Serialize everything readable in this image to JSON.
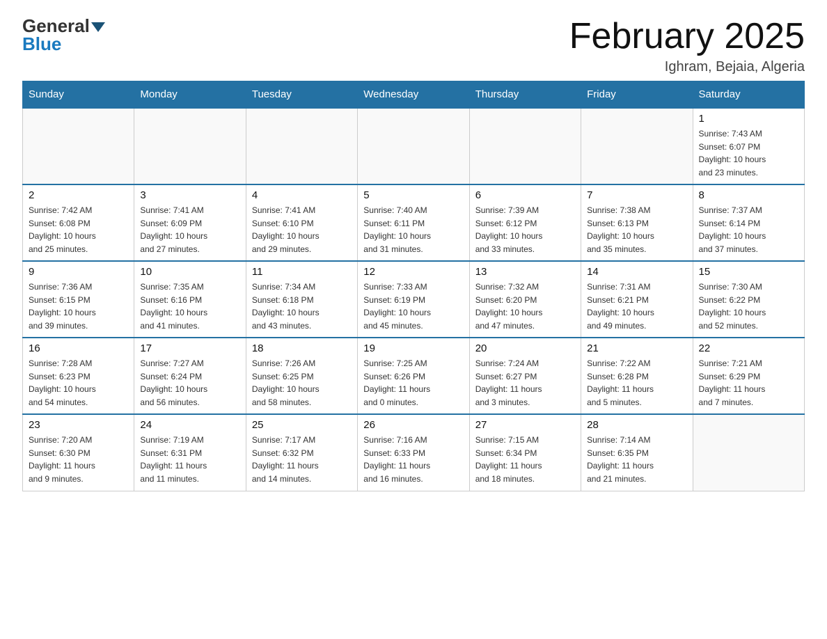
{
  "logo": {
    "general": "General",
    "blue": "Blue"
  },
  "header": {
    "month_year": "February 2025",
    "location": "Ighram, Bejaia, Algeria"
  },
  "weekdays": [
    "Sunday",
    "Monday",
    "Tuesday",
    "Wednesday",
    "Thursday",
    "Friday",
    "Saturday"
  ],
  "weeks": [
    [
      {
        "day": "",
        "info": ""
      },
      {
        "day": "",
        "info": ""
      },
      {
        "day": "",
        "info": ""
      },
      {
        "day": "",
        "info": ""
      },
      {
        "day": "",
        "info": ""
      },
      {
        "day": "",
        "info": ""
      },
      {
        "day": "1",
        "info": "Sunrise: 7:43 AM\nSunset: 6:07 PM\nDaylight: 10 hours\nand 23 minutes."
      }
    ],
    [
      {
        "day": "2",
        "info": "Sunrise: 7:42 AM\nSunset: 6:08 PM\nDaylight: 10 hours\nand 25 minutes."
      },
      {
        "day": "3",
        "info": "Sunrise: 7:41 AM\nSunset: 6:09 PM\nDaylight: 10 hours\nand 27 minutes."
      },
      {
        "day": "4",
        "info": "Sunrise: 7:41 AM\nSunset: 6:10 PM\nDaylight: 10 hours\nand 29 minutes."
      },
      {
        "day": "5",
        "info": "Sunrise: 7:40 AM\nSunset: 6:11 PM\nDaylight: 10 hours\nand 31 minutes."
      },
      {
        "day": "6",
        "info": "Sunrise: 7:39 AM\nSunset: 6:12 PM\nDaylight: 10 hours\nand 33 minutes."
      },
      {
        "day": "7",
        "info": "Sunrise: 7:38 AM\nSunset: 6:13 PM\nDaylight: 10 hours\nand 35 minutes."
      },
      {
        "day": "8",
        "info": "Sunrise: 7:37 AM\nSunset: 6:14 PM\nDaylight: 10 hours\nand 37 minutes."
      }
    ],
    [
      {
        "day": "9",
        "info": "Sunrise: 7:36 AM\nSunset: 6:15 PM\nDaylight: 10 hours\nand 39 minutes."
      },
      {
        "day": "10",
        "info": "Sunrise: 7:35 AM\nSunset: 6:16 PM\nDaylight: 10 hours\nand 41 minutes."
      },
      {
        "day": "11",
        "info": "Sunrise: 7:34 AM\nSunset: 6:18 PM\nDaylight: 10 hours\nand 43 minutes."
      },
      {
        "day": "12",
        "info": "Sunrise: 7:33 AM\nSunset: 6:19 PM\nDaylight: 10 hours\nand 45 minutes."
      },
      {
        "day": "13",
        "info": "Sunrise: 7:32 AM\nSunset: 6:20 PM\nDaylight: 10 hours\nand 47 minutes."
      },
      {
        "day": "14",
        "info": "Sunrise: 7:31 AM\nSunset: 6:21 PM\nDaylight: 10 hours\nand 49 minutes."
      },
      {
        "day": "15",
        "info": "Sunrise: 7:30 AM\nSunset: 6:22 PM\nDaylight: 10 hours\nand 52 minutes."
      }
    ],
    [
      {
        "day": "16",
        "info": "Sunrise: 7:28 AM\nSunset: 6:23 PM\nDaylight: 10 hours\nand 54 minutes."
      },
      {
        "day": "17",
        "info": "Sunrise: 7:27 AM\nSunset: 6:24 PM\nDaylight: 10 hours\nand 56 minutes."
      },
      {
        "day": "18",
        "info": "Sunrise: 7:26 AM\nSunset: 6:25 PM\nDaylight: 10 hours\nand 58 minutes."
      },
      {
        "day": "19",
        "info": "Sunrise: 7:25 AM\nSunset: 6:26 PM\nDaylight: 11 hours\nand 0 minutes."
      },
      {
        "day": "20",
        "info": "Sunrise: 7:24 AM\nSunset: 6:27 PM\nDaylight: 11 hours\nand 3 minutes."
      },
      {
        "day": "21",
        "info": "Sunrise: 7:22 AM\nSunset: 6:28 PM\nDaylight: 11 hours\nand 5 minutes."
      },
      {
        "day": "22",
        "info": "Sunrise: 7:21 AM\nSunset: 6:29 PM\nDaylight: 11 hours\nand 7 minutes."
      }
    ],
    [
      {
        "day": "23",
        "info": "Sunrise: 7:20 AM\nSunset: 6:30 PM\nDaylight: 11 hours\nand 9 minutes."
      },
      {
        "day": "24",
        "info": "Sunrise: 7:19 AM\nSunset: 6:31 PM\nDaylight: 11 hours\nand 11 minutes."
      },
      {
        "day": "25",
        "info": "Sunrise: 7:17 AM\nSunset: 6:32 PM\nDaylight: 11 hours\nand 14 minutes."
      },
      {
        "day": "26",
        "info": "Sunrise: 7:16 AM\nSunset: 6:33 PM\nDaylight: 11 hours\nand 16 minutes."
      },
      {
        "day": "27",
        "info": "Sunrise: 7:15 AM\nSunset: 6:34 PM\nDaylight: 11 hours\nand 18 minutes."
      },
      {
        "day": "28",
        "info": "Sunrise: 7:14 AM\nSunset: 6:35 PM\nDaylight: 11 hours\nand 21 minutes."
      },
      {
        "day": "",
        "info": ""
      }
    ]
  ]
}
